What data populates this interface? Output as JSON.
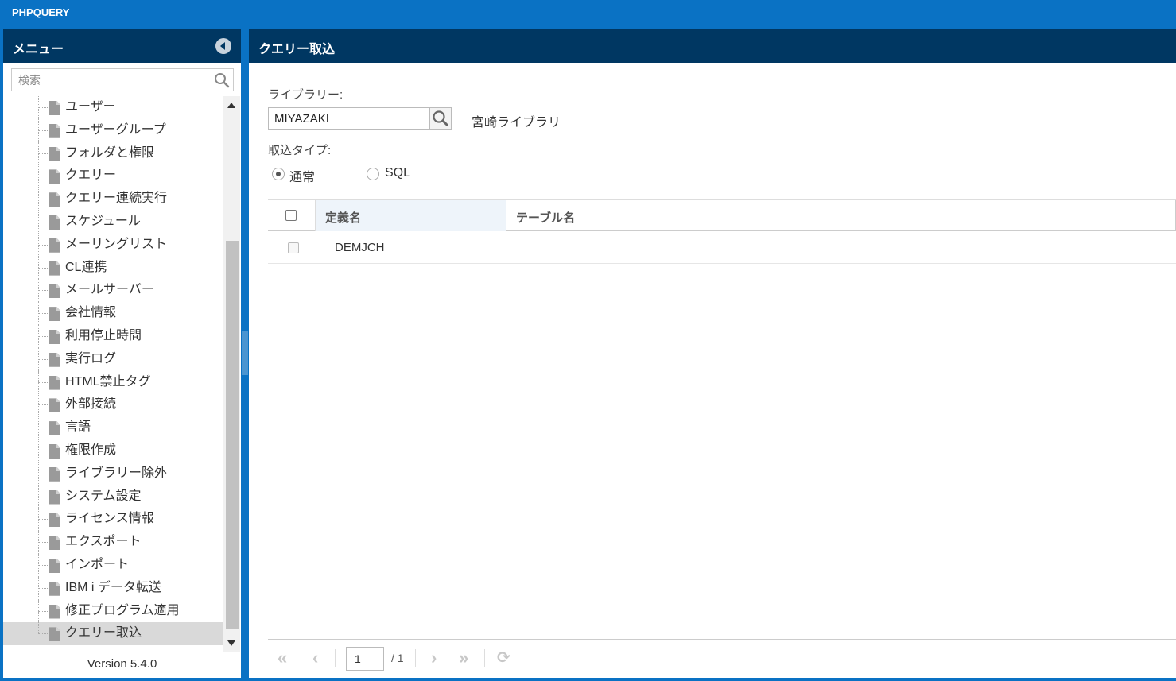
{
  "app": {
    "title": "PHPQUERY"
  },
  "sidebar": {
    "title": "メニュー",
    "search_placeholder": "検索",
    "items": [
      {
        "label": "ユーザー"
      },
      {
        "label": "ユーザーグループ"
      },
      {
        "label": "フォルダと権限"
      },
      {
        "label": "クエリー"
      },
      {
        "label": "クエリー連続実行"
      },
      {
        "label": "スケジュール"
      },
      {
        "label": "メーリングリスト"
      },
      {
        "label": "CL連携"
      },
      {
        "label": "メールサーバー"
      },
      {
        "label": "会社情報"
      },
      {
        "label": "利用停止時間"
      },
      {
        "label": "実行ログ"
      },
      {
        "label": "HTML禁止タグ"
      },
      {
        "label": "外部接続"
      },
      {
        "label": "言語"
      },
      {
        "label": "権限作成"
      },
      {
        "label": "ライブラリー除外"
      },
      {
        "label": "システム設定"
      },
      {
        "label": "ライセンス情報"
      },
      {
        "label": "エクスポート"
      },
      {
        "label": "インポート"
      },
      {
        "label": "IBM i データ転送"
      },
      {
        "label": "修正プログラム適用"
      },
      {
        "label": "クエリー取込",
        "selected": true
      }
    ],
    "version": "Version 5.4.0"
  },
  "main": {
    "title": "クエリー取込",
    "library_label": "ライブラリー:",
    "library_value": "MIYAZAKI",
    "library_name": "宮崎ライブラリ",
    "import_type_label": "取込タイプ:",
    "import_type_options": [
      {
        "label": "通常",
        "checked": true
      },
      {
        "label": "SQL",
        "checked": false
      }
    ],
    "grid": {
      "columns": [
        "定義名",
        "テーブル名"
      ],
      "rows": [
        {
          "definition": "DEMJCH",
          "table": ""
        }
      ]
    },
    "pager": {
      "current_page": "1",
      "total": "/ 1"
    }
  },
  "colors": {
    "topbar": "#0a72c4",
    "header": "#003762",
    "selected_item": "#d9d9d9"
  }
}
